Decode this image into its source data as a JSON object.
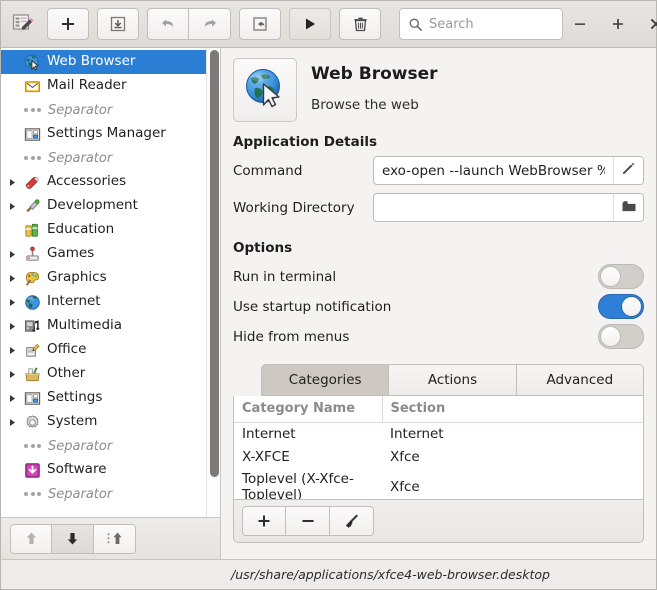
{
  "toolbar": {
    "logo_icon": "menu-editor-icon",
    "buttons": [
      {
        "name": "add-button",
        "icon": "plus-icon",
        "label": "+",
        "enabled": true
      },
      {
        "name": "save-button",
        "icon": "save-icon",
        "label": "",
        "enabled": true
      },
      {
        "name": "undo-button",
        "icon": "undo-icon",
        "label": "",
        "enabled": false
      },
      {
        "name": "redo-button",
        "icon": "redo-icon",
        "label": "",
        "enabled": false
      },
      {
        "name": "revert-button",
        "icon": "revert-icon",
        "label": "",
        "enabled": true
      },
      {
        "name": "run-button",
        "icon": "play-icon",
        "label": "",
        "enabled": true
      },
      {
        "name": "delete-button",
        "icon": "trash-icon",
        "label": "",
        "enabled": true
      }
    ],
    "search": {
      "placeholder": "Search",
      "value": "",
      "icon": "search-icon"
    },
    "window_controls": [
      {
        "name": "minimize-button",
        "glyph": "−"
      },
      {
        "name": "maximize-button",
        "glyph": "+"
      },
      {
        "name": "close-button",
        "glyph": "✕"
      }
    ]
  },
  "sidebar": {
    "items": [
      {
        "label": "Web Browser",
        "icon": "globe-icon",
        "type": "item",
        "selected": true,
        "expandable": false
      },
      {
        "label": "Mail Reader",
        "icon": "mail-icon",
        "type": "item",
        "selected": false,
        "expandable": false
      },
      {
        "label": "Separator",
        "icon": "separator-icon",
        "type": "separator",
        "selected": false,
        "expandable": false
      },
      {
        "label": "Settings Manager",
        "icon": "settings-manager-icon",
        "type": "item",
        "selected": false,
        "expandable": false
      },
      {
        "label": "Separator",
        "icon": "separator-icon",
        "type": "separator",
        "selected": false,
        "expandable": false
      },
      {
        "label": "Accessories",
        "icon": "accessories-icon",
        "type": "folder",
        "selected": false,
        "expandable": true
      },
      {
        "label": "Development",
        "icon": "development-icon",
        "type": "folder",
        "selected": false,
        "expandable": true
      },
      {
        "label": "Education",
        "icon": "education-icon",
        "type": "folder",
        "selected": false,
        "expandable": false
      },
      {
        "label": "Games",
        "icon": "games-icon",
        "type": "folder",
        "selected": false,
        "expandable": true
      },
      {
        "label": "Graphics",
        "icon": "graphics-icon",
        "type": "folder",
        "selected": false,
        "expandable": true
      },
      {
        "label": "Internet",
        "icon": "internet-icon",
        "type": "folder",
        "selected": false,
        "expandable": true
      },
      {
        "label": "Multimedia",
        "icon": "multimedia-icon",
        "type": "folder",
        "selected": false,
        "expandable": true
      },
      {
        "label": "Office",
        "icon": "office-icon",
        "type": "folder",
        "selected": false,
        "expandable": true
      },
      {
        "label": "Other",
        "icon": "other-icon",
        "type": "folder",
        "selected": false,
        "expandable": true
      },
      {
        "label": "Settings",
        "icon": "settings-icon",
        "type": "folder",
        "selected": false,
        "expandable": true
      },
      {
        "label": "System",
        "icon": "system-icon",
        "type": "folder",
        "selected": false,
        "expandable": true
      },
      {
        "label": "Separator",
        "icon": "separator-icon",
        "type": "separator",
        "selected": false,
        "expandable": false
      },
      {
        "label": "Software",
        "icon": "software-icon",
        "type": "item",
        "selected": false,
        "expandable": false
      },
      {
        "label": "Separator",
        "icon": "separator-icon",
        "type": "separator",
        "selected": false,
        "expandable": false
      }
    ],
    "footer_buttons": [
      {
        "name": "move-up-button",
        "icon": "arrow-up-icon",
        "enabled": false
      },
      {
        "name": "move-down-button",
        "icon": "arrow-down-icon",
        "enabled": true
      },
      {
        "name": "move-to-button",
        "icon": "move-to-icon",
        "enabled": true
      }
    ]
  },
  "main": {
    "app": {
      "icon": "globe-icon",
      "title": "Web Browser",
      "subtitle": "Browse the web"
    },
    "details_heading": "Application Details",
    "fields": [
      {
        "label": "Command",
        "value": "exo-open --launch WebBrowser %u",
        "placeholder": "",
        "button_icon": "pencil-icon"
      },
      {
        "label": "Working Directory",
        "value": "",
        "placeholder": "",
        "button_icon": "folder-icon"
      }
    ],
    "options_heading": "Options",
    "options": [
      {
        "label": "Run in terminal",
        "on": false
      },
      {
        "label": "Use startup notification",
        "on": true
      },
      {
        "label": "Hide from menus",
        "on": false
      }
    ],
    "tabs": [
      {
        "label": "Categories",
        "active": true
      },
      {
        "label": "Actions",
        "active": false
      },
      {
        "label": "Advanced",
        "active": false
      }
    ],
    "table": {
      "columns": [
        "Category Name",
        "Section"
      ],
      "rows": [
        [
          "Internet",
          "Internet"
        ],
        [
          "X-XFCE",
          "Xfce"
        ],
        [
          "Toplevel (X-Xfce-Toplevel)",
          "Xfce"
        ]
      ]
    },
    "table_buttons": [
      {
        "name": "add-category-button",
        "icon": "plus-icon",
        "glyph": "+"
      },
      {
        "name": "remove-category-button",
        "icon": "minus-icon",
        "glyph": "−"
      },
      {
        "name": "clear-categories-button",
        "icon": "broom-icon",
        "glyph": ""
      }
    ]
  },
  "statusbar": {
    "path": "/usr/share/applications/xfce4-web-browser.desktop"
  },
  "colors": {
    "selection": "#2a7fd4",
    "toggle_on": "#2f7fd8",
    "window_bg": "#f4f3f2",
    "header_bg": "#e8e6e3"
  }
}
